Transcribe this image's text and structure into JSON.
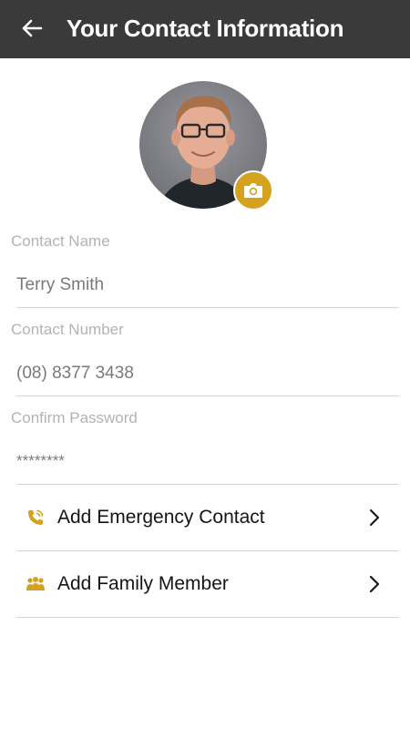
{
  "header": {
    "title": "Your Contact Information",
    "back_icon": "arrow-left-icon"
  },
  "profile": {
    "camera_icon": "camera-icon",
    "accent_color": "#d4a21f"
  },
  "form": {
    "contact_name": {
      "label": "Contact Name",
      "value": "Terry Smith"
    },
    "contact_number": {
      "label": "Contact Number",
      "value": "(08) 8377 3438"
    },
    "confirm_password": {
      "label": "Confirm Password",
      "value": "********"
    }
  },
  "actions": [
    {
      "label": "Add Emergency Contact",
      "icon": "phone-icon",
      "chevron": "chevron-right-icon"
    },
    {
      "label": "Add Family Member",
      "icon": "family-icon",
      "chevron": "chevron-right-icon"
    }
  ],
  "colors": {
    "header_bg": "#3a3a3a",
    "accent": "#d4a21f"
  }
}
